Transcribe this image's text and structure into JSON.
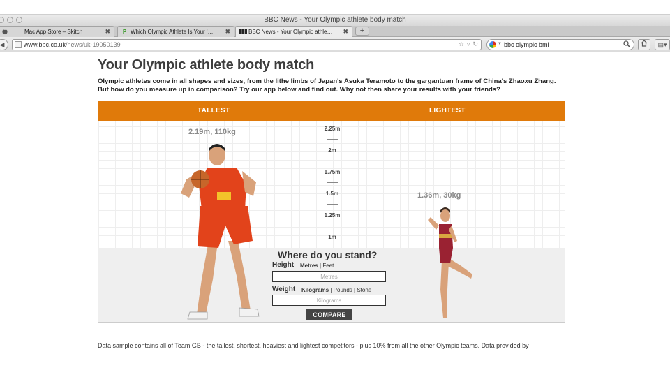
{
  "window": {
    "title": "BBC News - Your Olympic athlete body match"
  },
  "tabs": [
    {
      "label": "Mac App Store – Skitch",
      "icon": "apple-icon"
    },
    {
      "label": "Which Olympic Athlete Is Your '…",
      "icon": "p-favicon-icon"
    },
    {
      "label": "BBC News - Your Olympic athle…",
      "icon": "bbc-favicon-icon"
    }
  ],
  "newtab_label": "+",
  "address": {
    "host": "www.bbc.co.uk",
    "path": "/news/uk-19050139"
  },
  "search": {
    "value": "bbc olympic bmi"
  },
  "page": {
    "headline": "Your Olympic athlete body match",
    "intro": "Olympic athletes come in all shapes and sizes, from the lithe limbs of Japan's Asuka Teramoto to the gargantuan frame of China's Zhaoxu Zhang. But how do you measure up in comparison? Try our app below and find out. Why not then share your results with your friends?",
    "footnote": "Data sample contains all of Team GB - the tallest, shortest, heaviest and lightest competitors - plus 10% from all the other Olympic teams. Data provided by"
  },
  "app": {
    "accent": "#e07a0a",
    "tallest_label": "TALLEST",
    "lightest_label": "LIGHTEST",
    "tallest_stat": "2.19m, 110kg",
    "lightest_stat": "1.36m, 30kg",
    "scale_ticks": [
      "2.25m",
      "2m",
      "1.75m",
      "1.5m",
      "1.25m",
      "1m"
    ],
    "form": {
      "title": "Where do you stand?",
      "height_label": "Height",
      "height_units": {
        "selected": "Metres",
        "separator": " | ",
        "other": "Feet"
      },
      "height_placeholder": "Metres",
      "weight_label": "Weight",
      "weight_units": {
        "selected": "Kilograms",
        "separator": " | ",
        "other1": "Pounds",
        "separator2": " | ",
        "other2": "Stone"
      },
      "weight_placeholder": "Kilograms",
      "compare_label": "COMPARE"
    }
  }
}
